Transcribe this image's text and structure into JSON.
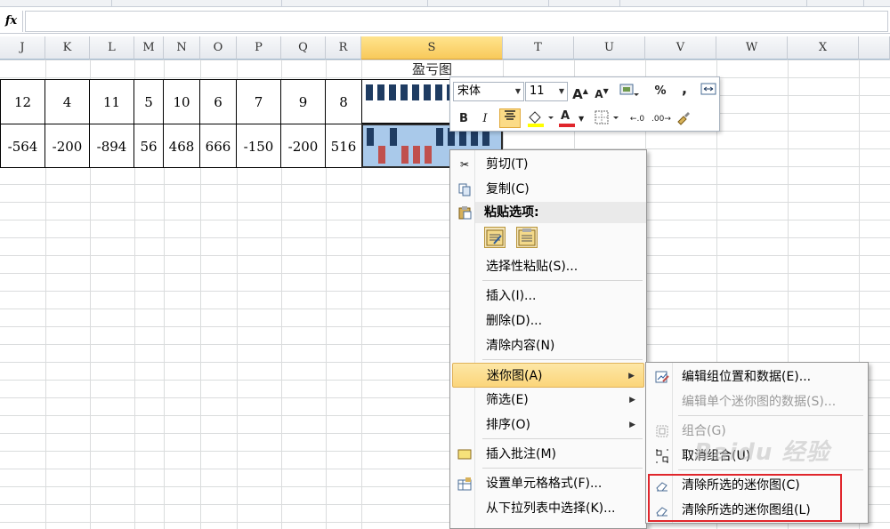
{
  "formula_bar": {
    "fx_label": "fx",
    "value": ""
  },
  "columns": [
    "J",
    "K",
    "L",
    "M",
    "N",
    "O",
    "P",
    "Q",
    "R",
    "S",
    "T",
    "U",
    "V",
    "W",
    "X"
  ],
  "selected_column": "S",
  "sparkline_title": "盈亏图",
  "row1": [
    "12",
    "4",
    "11",
    "5",
    "10",
    "6",
    "7",
    "9",
    "8"
  ],
  "row2": [
    "-564",
    "-200",
    "-894",
    "56",
    "468",
    "666",
    "-150",
    "-200",
    "516"
  ],
  "colors": {
    "sparkline_blue": "#1f3c62",
    "sparkline_red": "#c0504d",
    "selection_fill": "#a9c9ea",
    "highlight_red_box": "#e0262c",
    "font_color_red": "#e0262c",
    "fill_color_yellow": "#ffff00"
  },
  "mini_toolbar": {
    "font_name": "宋体",
    "font_size": "11",
    "grow_font": "A",
    "shrink_font": "A",
    "percent": "%",
    "comma": ",",
    "bold": "B",
    "italic": "I",
    "font_color": "A"
  },
  "context_menu": {
    "cut": "剪切(T)",
    "copy": "复制(C)",
    "paste_options": "粘贴选项:",
    "paste_special": "选择性粘贴(S)...",
    "insert": "插入(I)...",
    "delete": "删除(D)...",
    "clear": "清除内容(N)",
    "sparklines": "迷你图(A)",
    "filter": "筛选(E)",
    "sort": "排序(O)",
    "insert_comment": "插入批注(M)",
    "format_cells": "设置单元格格式(F)...",
    "pick_from_list": "从下拉列表中选择(K)..."
  },
  "sparkline_submenu": {
    "edit_group": "编辑组位置和数据(E)...",
    "edit_single": "编辑单个迷你图的数据(S)...",
    "group": "组合(G)",
    "ungroup": "取消组合(U)",
    "clear_selected": "清除所选的迷你图(C)",
    "clear_selected_group": "清除所选的迷你图组(L)"
  },
  "watermark": "Baidu 经验"
}
